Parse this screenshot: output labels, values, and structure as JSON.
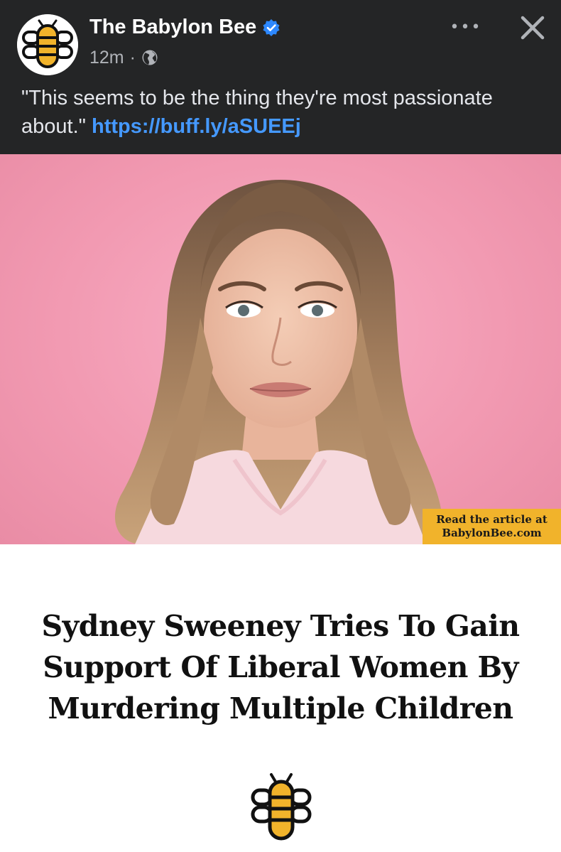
{
  "post": {
    "author": "The Babylon Bee",
    "time": "12m",
    "separator": "·",
    "audience_icon": "globe-icon",
    "verified_icon": "verified-badge-icon",
    "caption_text": "\"This seems to be the thing they're most passionate about.\" ",
    "caption_link": "https://buff.ly/aSUEEj",
    "more_icon": "more-options-icon",
    "close_icon": "close-icon",
    "more_glyph": "•••",
    "close_glyph": "✕"
  },
  "image": {
    "badge_line1": "Read the article at",
    "badge_line2": "BabylonBee.com"
  },
  "article": {
    "headline_line1": "Sydney Sweeney Tries To Gain",
    "headline_line2": "Support Of Liberal Women By",
    "headline_line3": "Murdering Multiple Children",
    "logo_icon": "babylon-bee-logo-icon"
  },
  "colors": {
    "header_bg": "#242526",
    "link": "#4599ff",
    "verified": "#2d88ff",
    "photo_bg": "#f29ab2",
    "badge_bg": "#f1b32b",
    "bee_yellow": "#f1b32b"
  }
}
